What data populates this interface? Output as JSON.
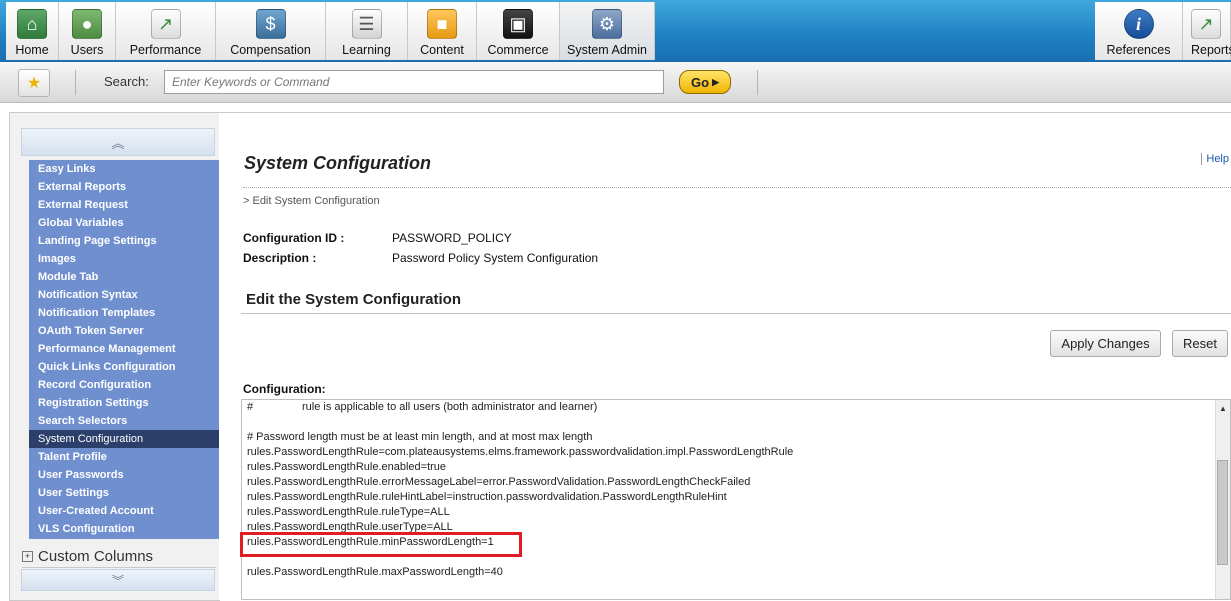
{
  "nav": {
    "items": [
      {
        "label": "Home",
        "icon": "home-icon"
      },
      {
        "label": "Users",
        "icon": "users-icon"
      },
      {
        "label": "Performance",
        "icon": "performance-chart-icon"
      },
      {
        "label": "Compensation",
        "icon": "compensation-icon"
      },
      {
        "label": "Learning",
        "icon": "learning-document-icon"
      },
      {
        "label": "Content",
        "icon": "content-folder-icon"
      },
      {
        "label": "Commerce",
        "icon": "commerce-briefcase-icon"
      },
      {
        "label": "System Admin",
        "icon": "system-admin-icon",
        "active": true
      }
    ],
    "right_items": [
      {
        "label": "References",
        "icon": "info-icon"
      },
      {
        "label": "Reports",
        "icon": "reports-chart-icon"
      }
    ]
  },
  "search": {
    "label": "Search:",
    "placeholder": "Enter Keywords or Command",
    "go_label": "Go"
  },
  "sidebar": {
    "items": [
      "Easy Links",
      "External Reports",
      "External Request",
      "Global Variables",
      "Landing Page Settings",
      "Images",
      "Module Tab",
      "Notification Syntax",
      "Notification Templates",
      "OAuth Token Server",
      "Performance Management",
      "Quick Links Configuration",
      "Record Configuration",
      "Registration Settings",
      "Search Selectors",
      "System Configuration",
      "Talent Profile",
      "User Passwords",
      "User Settings",
      "User-Created Account",
      "VLS Configuration"
    ],
    "selected": "System Configuration",
    "section": "Custom Columns"
  },
  "main": {
    "title": "System Configuration",
    "help": "Help",
    "breadcrumb": "> Edit System Configuration",
    "config_id_label": "Configuration ID :",
    "config_id_value": "PASSWORD_POLICY",
    "description_label": "Description :",
    "description_value": "Password Policy System Configuration",
    "section_title": "Edit the System Configuration",
    "apply_label": "Apply Changes",
    "reset_label": "Reset",
    "config_label": "Configuration:",
    "config_lines": [
      "#                rule is applicable to all users (both administrator and learner)",
      "",
      "# Password length must be at least min length, and at most max length",
      "rules.PasswordLengthRule=com.plateausystems.elms.framework.passwordvalidation.impl.PasswordLengthRule",
      "rules.PasswordLengthRule.enabled=true",
      "rules.PasswordLengthRule.errorMessageLabel=error.PasswordValidation.PasswordLengthCheckFailed",
      "rules.PasswordLengthRule.ruleHintLabel=instruction.passwordvalidation.PasswordLengthRuleHint",
      "rules.PasswordLengthRule.ruleType=ALL",
      "rules.PasswordLengthRule.userType=ALL",
      "rules.PasswordLengthRule.minPasswordLength=1",
      "",
      "rules.PasswordLengthRule.maxPasswordLength=40"
    ]
  },
  "colors": {
    "nav_blue": "#1e7fc2",
    "sidebar_blue": "#6f8fcf",
    "sidebar_selected": "#2b3f6a",
    "highlight_red": "#e01c24",
    "go_yellow": "#f0b400"
  }
}
